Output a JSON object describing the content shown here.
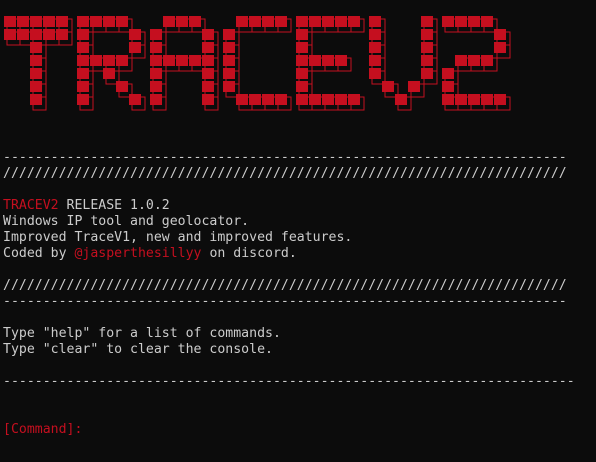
{
  "banner": {
    "text": "TRACEV2",
    "color": "#c50f1f",
    "shadow_color": "#c50f1f"
  },
  "console": {
    "rule_dash": "-----------------------------------------------------------------------",
    "rule_slash": "///////////////////////////////////////////////////////////////////////",
    "rule_dash_long": "------------------------------------------------------------------------",
    "release_name": "TRACEV2",
    "release_rest": " RELEASE 1.0.2",
    "line_tool": "Windows IP tool and geolocator.",
    "line_improved": "Improved TraceV1, new and improved features.",
    "coded_prefix": "Coded by ",
    "coded_handle": "@jasperthesillyy",
    "coded_suffix": " on discord.",
    "help_line": "Type \"help\" for a list of commands.",
    "clear_line": "Type \"clear\" to clear the console.",
    "prompt": "[Command]:"
  },
  "colors": {
    "background": "#0c0c0c",
    "text": "#cccccc",
    "accent_red": "#c50f1f"
  }
}
